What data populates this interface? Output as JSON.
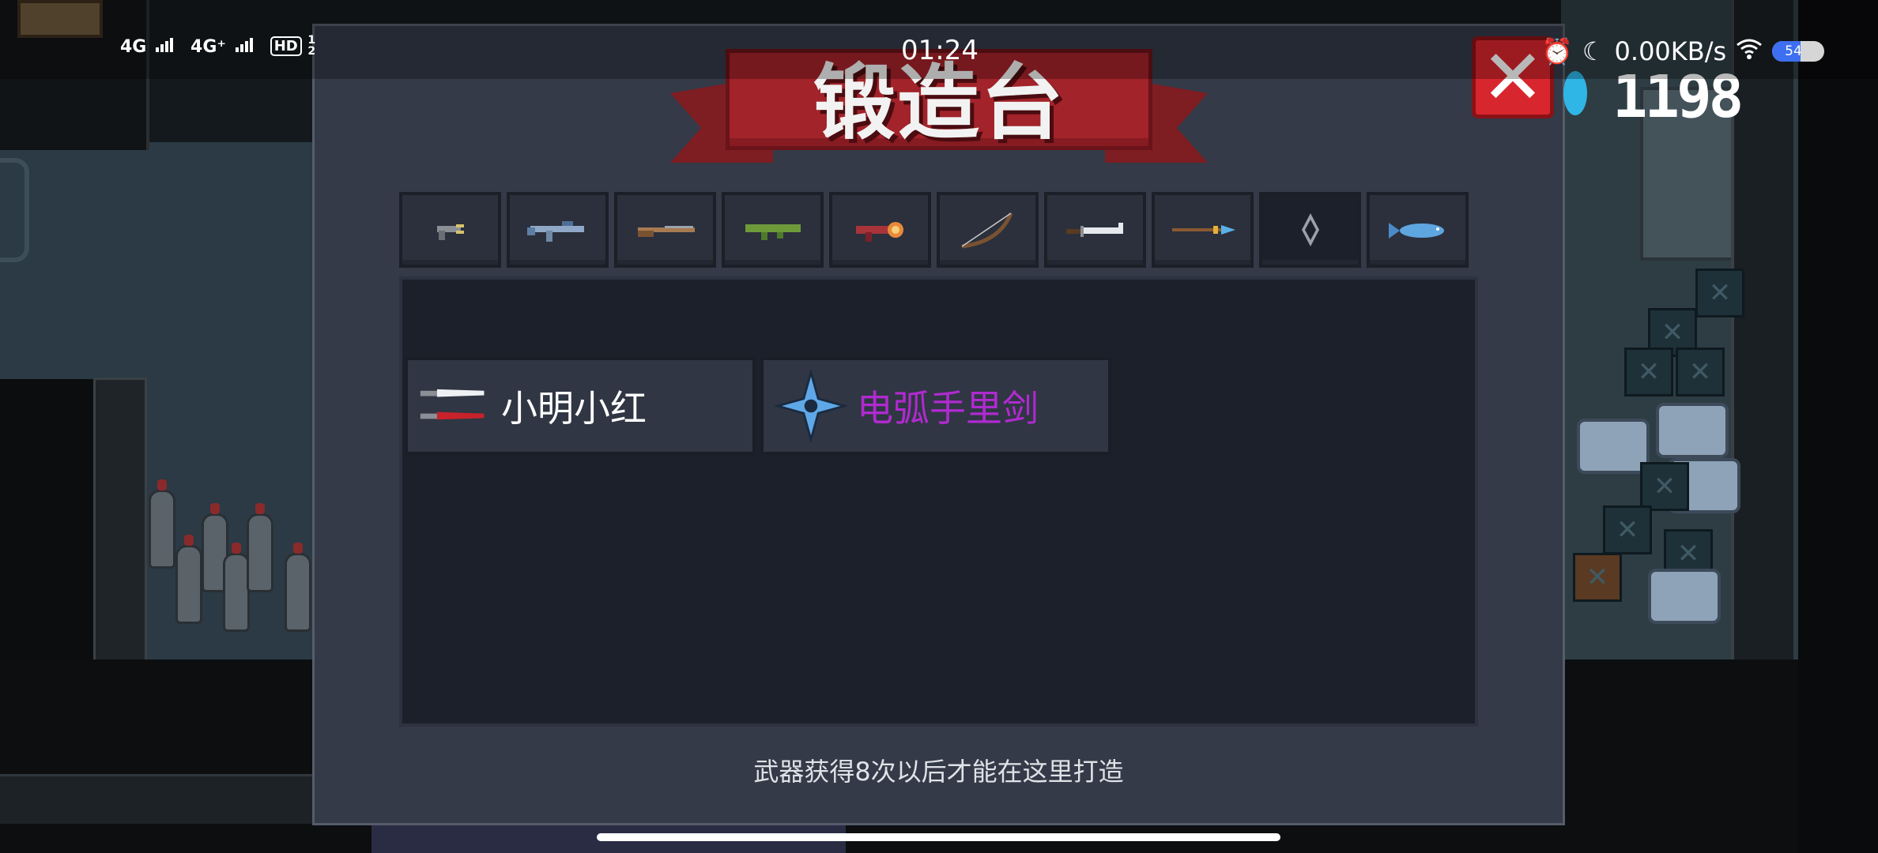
{
  "status_bar": {
    "signal_1": "4G",
    "signal_2": "4G⁺",
    "hd_badge": "HD",
    "hd_index": "1",
    "hd_sub": "2",
    "time": "01:24",
    "network_speed": "0.00KB/s",
    "battery_level": "54",
    "icons": [
      "alarm-icon",
      "moon-icon",
      "wifi-icon",
      "battery-icon"
    ]
  },
  "forge": {
    "title": "锻造台",
    "tabs": [
      {
        "icon": "pistol-icon"
      },
      {
        "icon": "rifle-icon"
      },
      {
        "icon": "shotgun-icon"
      },
      {
        "icon": "rocket-launcher-icon"
      },
      {
        "icon": "laser-gun-icon"
      },
      {
        "icon": "bow-icon"
      },
      {
        "icon": "sword-icon"
      },
      {
        "icon": "spear-icon"
      },
      {
        "icon": "shuriken-tab-icon",
        "active": true
      },
      {
        "icon": "fish-icon"
      }
    ],
    "items": [
      {
        "name": "小明小红",
        "color": "#ffffff",
        "icon": "twin-knives-icon"
      },
      {
        "name": "电弧手里剑",
        "color": "#b02ad0",
        "icon": "arc-shuriken-icon"
      }
    ],
    "hint": "武器获得8次以后才能在这里打造"
  },
  "hud": {
    "gem_count": "1198",
    "gem_color": "#2fb6e6"
  },
  "colors": {
    "panel_bg": "#343a47",
    "banner_red": "#a2232a",
    "close_red": "#d8262e"
  }
}
